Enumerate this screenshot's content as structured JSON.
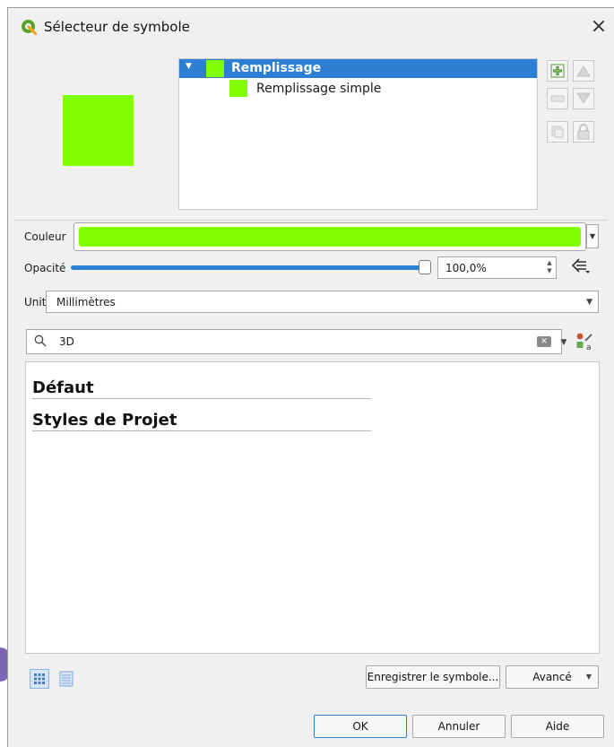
{
  "window": {
    "title": "Sélecteur de symbole",
    "close_glyph": "×",
    "logo_icon": "qgis-logo-icon",
    "background": "#f0f0f0"
  },
  "preview": {
    "fill_color": "#80ff00"
  },
  "layer_tree": {
    "items": [
      {
        "label": "Remplissage",
        "color": "#80ff00",
        "selected": true,
        "expanded": true
      },
      {
        "label": "Remplissage simple",
        "color": "#80ff00",
        "selected": false
      }
    ],
    "selection_color": "#2d7fd3"
  },
  "layer_buttons": {
    "add": "add-layer-icon",
    "remove": "remove-layer-icon",
    "duplicate": "duplicate-layer-icon",
    "move_up": "move-up-icon",
    "move_down": "move-down-icon",
    "lock": "lock-icon"
  },
  "color": {
    "label": "Couleur",
    "value": "#80ff00"
  },
  "opacity": {
    "label": "Opacité",
    "value_text": "100,0%",
    "level": 1.0,
    "track_color": "#2c80d4"
  },
  "unit": {
    "label": "Unité",
    "value": "Millimètres"
  },
  "search": {
    "value": "3D"
  },
  "style_groups": [
    "Défaut",
    "Styles de Projet"
  ],
  "footer": {
    "save_symbol": "Enregistrer le symbole...",
    "advanced": "Avancé"
  },
  "dialog_buttons": {
    "ok": "OK",
    "cancel": "Annuler",
    "help": "Aide"
  }
}
